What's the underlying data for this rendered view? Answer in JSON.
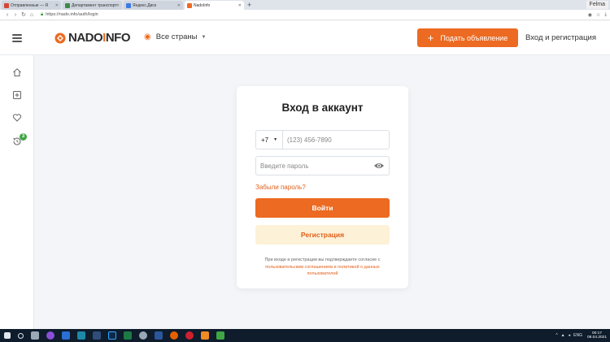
{
  "browser": {
    "tabs": [
      {
        "title": "Отправленные — Я",
        "color": "#d44638",
        "active": false
      },
      {
        "title": "Департамент транспорт",
        "color": "#3c8a4a",
        "active": false
      },
      {
        "title": "Яндекс.Диск",
        "color": "#3d7be3",
        "active": false
      },
      {
        "title": "NadoInfo",
        "color": "#ec6a21",
        "active": true
      }
    ],
    "new_tab": "+",
    "user": "Felma",
    "url": "https://nado.info/auth/login",
    "zoom": "⊕ зоом"
  },
  "header": {
    "logo_prefix": "NADO",
    "logo_o": "I",
    "logo_suffix": "NFO",
    "region": "Все страны",
    "post_button": "Подать объявление",
    "login_link": "Вход и регистрация",
    "accent": "#ec6a21"
  },
  "rail": {
    "badge": "3",
    "icons": [
      "home-icon",
      "add-icon",
      "heart-icon",
      "history-icon"
    ]
  },
  "login": {
    "title": "Вход в аккаунт",
    "country_code": "+7",
    "phone_placeholder": "(123) 456-7890",
    "password_placeholder": "Введите пароль",
    "forgot": "Забыли пароль?",
    "login_button": "Войти",
    "register_button": "Регистрация",
    "terms_prefix": "При входе и регистрации вы подтверждаете согласие с",
    "terms_link_1": "пользовательским соглашением",
    "terms_and": "и",
    "terms_link_2": "политикой о данных пользователей"
  },
  "taskbar": {
    "lang": "ENG",
    "time": "00:17",
    "date": "08.04.2021"
  }
}
